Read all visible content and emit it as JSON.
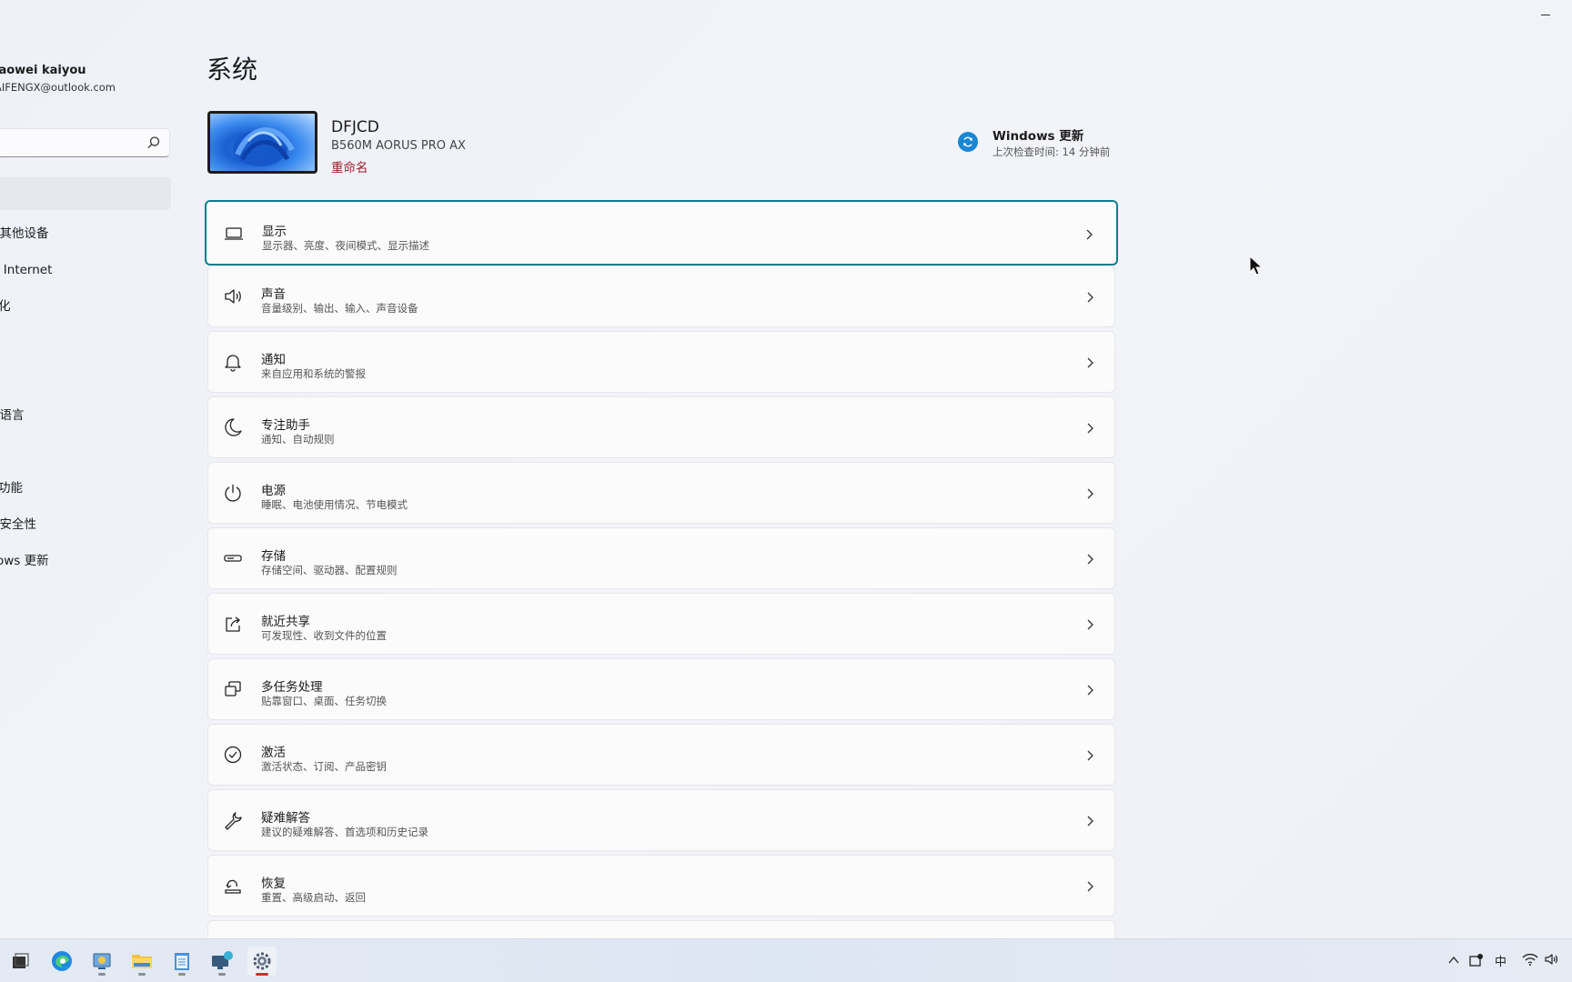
{
  "window": {
    "minimize_glyph": "—"
  },
  "sidebar": {
    "user_name": "iaowei kaiyou",
    "user_email": "AIFENGX@outlook.com",
    "search_placeholder": "",
    "items": [
      {
        "label": "口其他设备"
      },
      {
        "label": "口 Internet"
      },
      {
        "label": "化"
      },
      {
        "label": "口语言"
      },
      {
        "label": "功能"
      },
      {
        "label": "口安全性"
      },
      {
        "label": "ows 更新"
      }
    ]
  },
  "main": {
    "title": "系统",
    "device": {
      "name": "DFJCD",
      "model": "B560M AORUS PRO AX",
      "rename": "重命名"
    },
    "update": {
      "title": "Windows 更新",
      "subtitle": "上次检查时间: 14 分钟前"
    },
    "cards": [
      {
        "title": "显示",
        "subtitle": "显示器、亮度、夜间模式、显示描述",
        "icon": "monitor-icon"
      },
      {
        "title": "声音",
        "subtitle": "音量级别、输出、输入、声音设备",
        "icon": "speaker-icon"
      },
      {
        "title": "通知",
        "subtitle": "来自应用和系统的警报",
        "icon": "bell-icon"
      },
      {
        "title": "专注助手",
        "subtitle": "通知、自动规则",
        "icon": "moon-icon"
      },
      {
        "title": "电源",
        "subtitle": "睡眠、电池使用情况、节电模式",
        "icon": "power-icon"
      },
      {
        "title": "存储",
        "subtitle": "存储空间、驱动器、配置规则",
        "icon": "storage-icon"
      },
      {
        "title": "就近共享",
        "subtitle": "可发现性、收到文件的位置",
        "icon": "share-icon"
      },
      {
        "title": "多任务处理",
        "subtitle": "贴靠窗口、桌面、任务切换",
        "icon": "multitask-icon"
      },
      {
        "title": "激活",
        "subtitle": "激活状态、订阅、产品密钥",
        "icon": "check-circle-icon"
      },
      {
        "title": "疑难解答",
        "subtitle": "建议的疑难解答、首选项和历史记录",
        "icon": "wrench-icon"
      },
      {
        "title": "恢复",
        "subtitle": "重置、高级启动、返回",
        "icon": "recovery-icon"
      }
    ]
  },
  "taskbar": {
    "tray": {
      "ime": "中"
    }
  },
  "colors": {
    "accent_focus": "#0f7d8c",
    "rename_link": "#9a1f2b",
    "update_icon": "#1a86d4"
  }
}
